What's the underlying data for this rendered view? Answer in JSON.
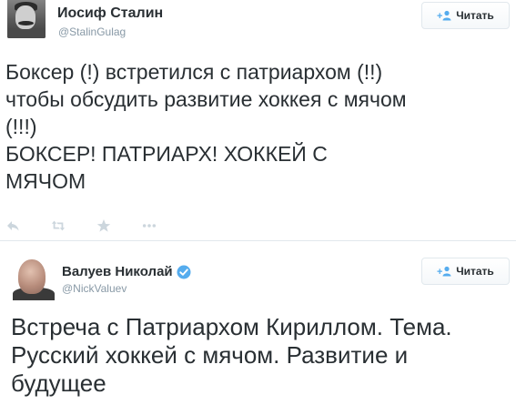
{
  "tweets": [
    {
      "author_name": "Иосиф Сталин",
      "handle": "@StalinGulag",
      "follow_label": "Читать",
      "text_lines": [
        "Боксер (!) встретился с патриархом (!!)",
        "чтобы обсудить развитие хоккея с мячом",
        "(!!!)",
        "БОКСЕР! ПАТРИАРХ! ХОККЕЙ С",
        "МЯЧОМ"
      ],
      "actions": [
        "reply-icon",
        "retweet-icon",
        "favorite-icon",
        "more-icon"
      ]
    },
    {
      "author_name": "Валуев Николай",
      "handle": "@NickValuev",
      "verified": true,
      "follow_label": "Читать",
      "text_lines": [
        "Встреча с Патриархом Кириллом. Тема.",
        "Русский хоккей с мячом. Развитие и",
        "будущее"
      ]
    }
  ],
  "colors": {
    "text": "#292f33",
    "muted": "#8899a6",
    "action_icon": "#ccd6dd",
    "follow_icon": "#55acee",
    "verified": "#55acee",
    "border": "#e1e8ed"
  }
}
